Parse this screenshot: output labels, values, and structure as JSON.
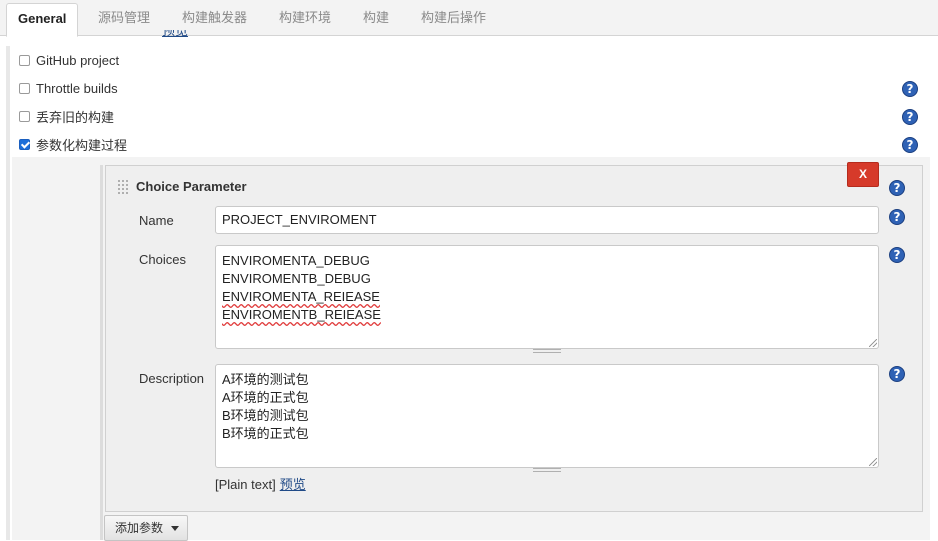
{
  "tabs": [
    {
      "label": "General",
      "active": true
    },
    {
      "label": "源码管理"
    },
    {
      "label": "构建触发器"
    },
    {
      "label": "构建环境"
    },
    {
      "label": "构建"
    },
    {
      "label": "构建后操作"
    }
  ],
  "options": [
    {
      "label": "GitHub project",
      "checked": false,
      "help": false
    },
    {
      "label": "Throttle builds",
      "checked": false,
      "help": true
    },
    {
      "label": "丢弃旧的构建",
      "checked": false,
      "help": true
    },
    {
      "label": "参数化构建过程",
      "checked": true,
      "help": true
    }
  ],
  "parameter": {
    "title": "Choice Parameter",
    "delete_label": "X",
    "name_label": "Name",
    "name_value": "PROJECT_ENVIROMENT",
    "choices_label": "Choices",
    "choices": [
      "ENVIROMENTA_DEBUG",
      "ENVIROMENTB_DEBUG",
      "ENVIROMENTA_REIEASE",
      "ENVIROMENTB_REIEASE"
    ],
    "description_label": "Description",
    "description": [
      "A环境的测试包",
      "A环境的正式包",
      "B环境的测试包",
      "B环境的正式包"
    ],
    "plain_text": "[Plain text]",
    "preview_link": "预览"
  },
  "add_param_label": "添加参数",
  "help_glyph": "?",
  "colors": {
    "accent_blue": "#2f62b5",
    "delete_red": "#d63a2a",
    "link": "#204a87"
  }
}
